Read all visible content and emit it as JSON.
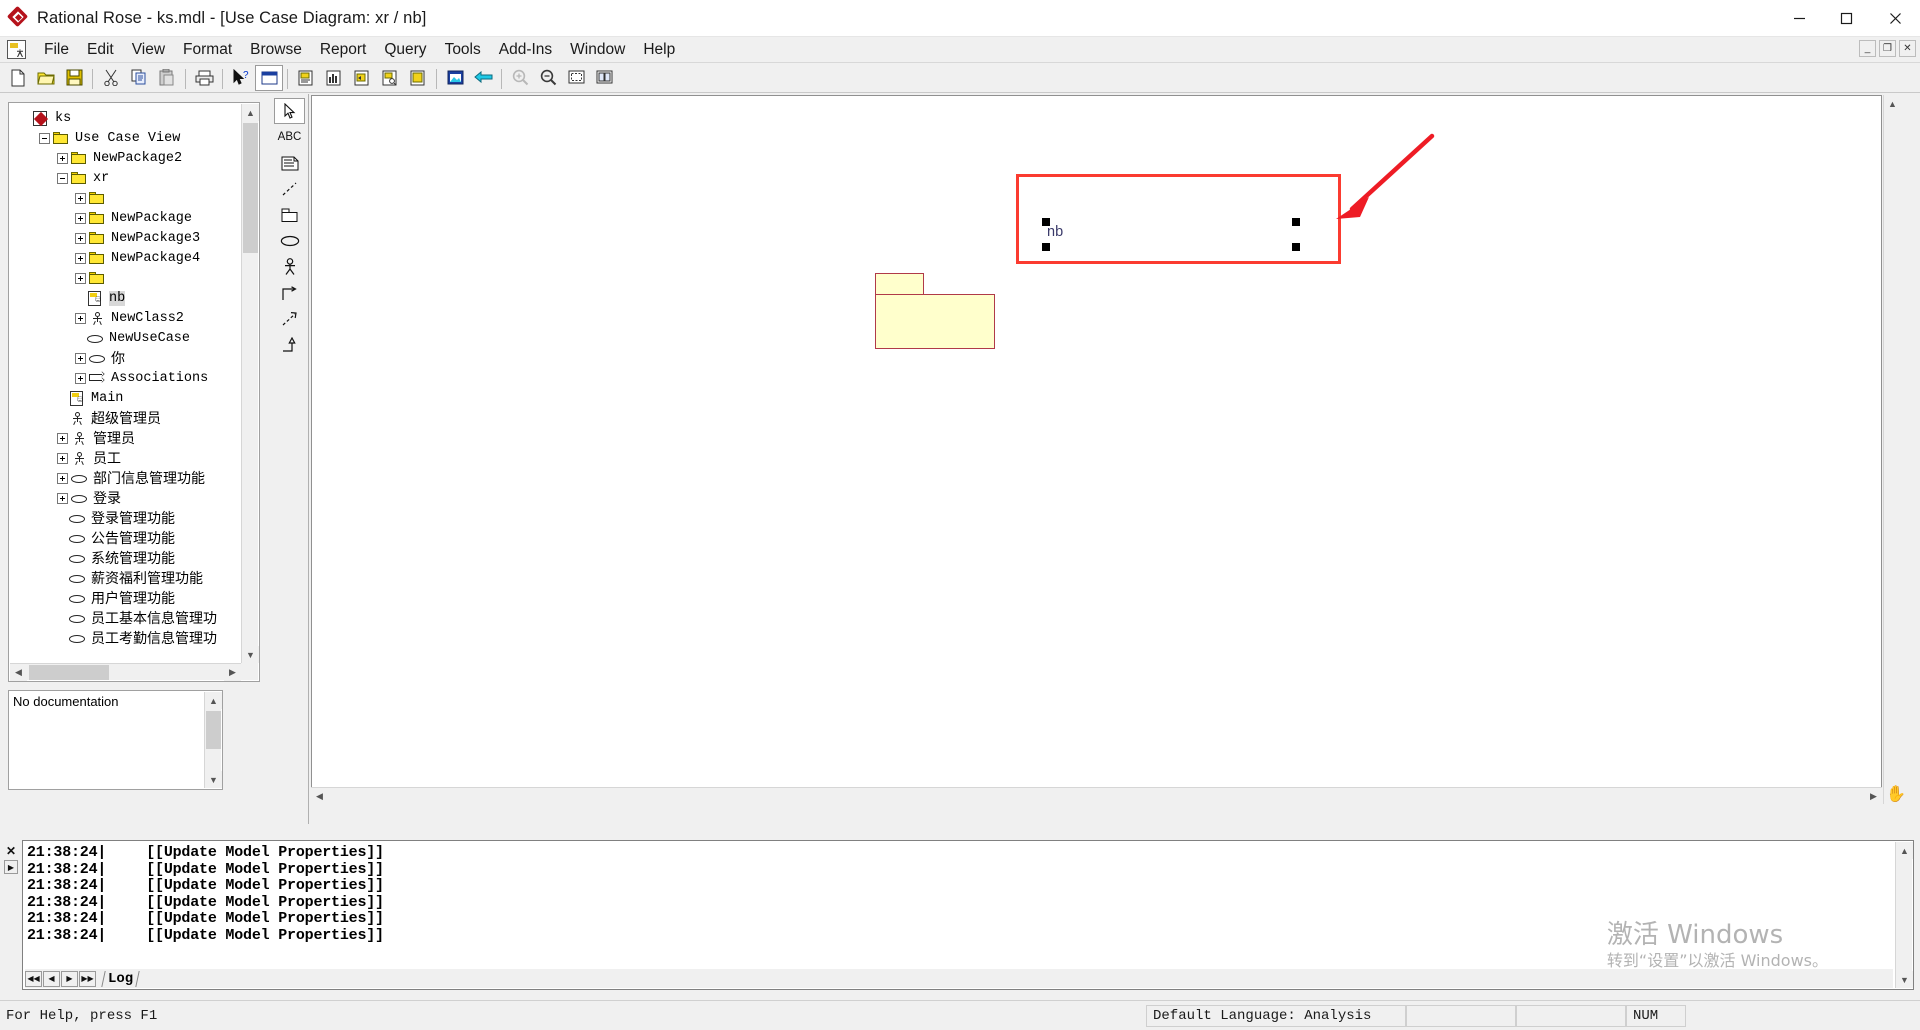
{
  "window": {
    "title": "Rational Rose - ks.mdl - [Use Case Diagram: xr / nb]",
    "app_icon": "rational-rose-diamond-icon",
    "minimize": "minimize-icon",
    "maximize": "maximize-icon",
    "close": "close-icon"
  },
  "menubar": {
    "items": [
      {
        "label": "File"
      },
      {
        "label": "Edit"
      },
      {
        "label": "View"
      },
      {
        "label": "Format"
      },
      {
        "label": "Browse"
      },
      {
        "label": "Report"
      },
      {
        "label": "Query"
      },
      {
        "label": "Tools"
      },
      {
        "label": "Add-Ins"
      },
      {
        "label": "Window"
      },
      {
        "label": "Help"
      }
    ],
    "mdi": {
      "minimize": "_",
      "restore": "❐",
      "close": "✕"
    }
  },
  "toolbar": {
    "buttons": [
      {
        "name": "new-icon"
      },
      {
        "name": "open-icon"
      },
      {
        "name": "save-icon"
      },
      {
        "name": "cut-icon"
      },
      {
        "name": "copy-icon"
      },
      {
        "name": "paste-icon"
      },
      {
        "name": "print-icon"
      },
      {
        "name": "context-help-icon"
      },
      {
        "name": "browse-class-icon"
      },
      {
        "name": "browse-parent-icon"
      },
      {
        "name": "browse-previous-diagram-icon"
      },
      {
        "name": "browse-parent-diagram-icon"
      },
      {
        "name": "browse-specification-icon"
      },
      {
        "name": "fit-in-window-icon"
      },
      {
        "name": "undo-fit-icon"
      },
      {
        "name": "zoom-in-icon"
      },
      {
        "name": "zoom-out-icon"
      },
      {
        "name": "show-hidden-icon"
      },
      {
        "name": "print-preview-icon"
      }
    ],
    "selected_index": 7
  },
  "browser": {
    "title": "browser-tree",
    "nodes": [
      {
        "label": "ks",
        "depth": 0,
        "toggle": "none",
        "icon": "model-icon"
      },
      {
        "label": "Use Case View",
        "depth": 1,
        "toggle": "minus",
        "icon": "folder-icon"
      },
      {
        "label": "NewPackage2",
        "depth": 2,
        "toggle": "plus",
        "icon": "folder-icon"
      },
      {
        "label": "xr",
        "depth": 2,
        "toggle": "minus",
        "icon": "folder-icon"
      },
      {
        "label": "",
        "depth": 3,
        "toggle": "plus",
        "icon": "folder-icon"
      },
      {
        "label": "NewPackage",
        "depth": 3,
        "toggle": "plus",
        "icon": "folder-icon"
      },
      {
        "label": "NewPackage3",
        "depth": 3,
        "toggle": "plus",
        "icon": "folder-icon"
      },
      {
        "label": "NewPackage4",
        "depth": 3,
        "toggle": "plus",
        "icon": "folder-icon"
      },
      {
        "label": "",
        "depth": 3,
        "toggle": "plus",
        "icon": "folder-icon"
      },
      {
        "label": "nb",
        "depth": 3,
        "toggle": "none",
        "icon": "usecase-diagram-icon",
        "selected": true
      },
      {
        "label": "NewClass2",
        "depth": 3,
        "toggle": "plus",
        "icon": "actor-icon"
      },
      {
        "label": "NewUseCase",
        "depth": 3,
        "toggle": "none",
        "icon": "usecase-icon"
      },
      {
        "label": "你",
        "depth": 3,
        "toggle": "plus",
        "icon": "usecase-icon",
        "cjk": true
      },
      {
        "label": "Associations",
        "depth": 3,
        "toggle": "plus",
        "icon": "association-icon"
      },
      {
        "label": "Main",
        "depth": 2,
        "toggle": "none",
        "icon": "usecase-diagram-icon"
      },
      {
        "label": "超级管理员",
        "depth": 2,
        "toggle": "none",
        "icon": "actor-icon",
        "cjk": true
      },
      {
        "label": "管理员",
        "depth": 2,
        "toggle": "plus",
        "icon": "actor-icon",
        "cjk": true
      },
      {
        "label": "员工",
        "depth": 2,
        "toggle": "plus",
        "icon": "actor-icon",
        "cjk": true
      },
      {
        "label": "部门信息管理功能",
        "depth": 2,
        "toggle": "plus",
        "icon": "usecase-icon",
        "cjk": true
      },
      {
        "label": "登录",
        "depth": 2,
        "toggle": "plus",
        "icon": "usecase-icon",
        "cjk": true
      },
      {
        "label": "登录管理功能",
        "depth": 2,
        "toggle": "none",
        "icon": "usecase-icon",
        "cjk": true
      },
      {
        "label": "公告管理功能",
        "depth": 2,
        "toggle": "none",
        "icon": "usecase-icon",
        "cjk": true
      },
      {
        "label": "系统管理功能",
        "depth": 2,
        "toggle": "none",
        "icon": "usecase-icon",
        "cjk": true
      },
      {
        "label": "薪资福利管理功能",
        "depth": 2,
        "toggle": "none",
        "icon": "usecase-icon",
        "cjk": true
      },
      {
        "label": "用户管理功能",
        "depth": 2,
        "toggle": "none",
        "icon": "usecase-icon",
        "cjk": true
      },
      {
        "label": "员工基本信息管理功",
        "depth": 2,
        "toggle": "none",
        "icon": "usecase-icon",
        "cjk": true
      },
      {
        "label": "员工考勤信息管理功",
        "depth": 2,
        "toggle": "none",
        "icon": "usecase-icon",
        "cjk": true
      }
    ]
  },
  "documentation": {
    "text": "No documentation"
  },
  "palette": {
    "tools": [
      {
        "name": "selection-arrow-tool",
        "selected": true
      },
      {
        "name": "text-abc-tool",
        "label": "ABC"
      },
      {
        "name": "note-tool"
      },
      {
        "name": "anchor-note-to-item-tool"
      },
      {
        "name": "package-tool"
      },
      {
        "name": "use-case-tool"
      },
      {
        "name": "actor-tool"
      },
      {
        "name": "unidirectional-association-tool"
      },
      {
        "name": "dependency-tool"
      },
      {
        "name": "generalization-tool"
      }
    ]
  },
  "diagram": {
    "package": {
      "name": "package-shape",
      "fill": "#ffffcc",
      "stroke": "#b03a48"
    },
    "selection": {
      "name": "nb-selection-rectangle",
      "color": "#fb3b30"
    },
    "selected_label": "nb",
    "annotation_arrow": {
      "name": "red-pointer-arrow",
      "color": "#ee1c25"
    }
  },
  "log": {
    "tab_label": "Log",
    "rows": [
      {
        "time": "21:38:24|",
        "message": "[[Update Model Properties]]"
      },
      {
        "time": "21:38:24|",
        "message": "[[Update Model Properties]]"
      },
      {
        "time": "21:38:24|",
        "message": "[[Update Model Properties]]"
      },
      {
        "time": "21:38:24|",
        "message": "[[Update Model Properties]]"
      },
      {
        "time": "21:38:24|",
        "message": "[[Update Model Properties]]"
      },
      {
        "time": "21:38:24|",
        "message": "[[Update Model Properties]]"
      }
    ],
    "nav": {
      "first": "◀◀",
      "prev": "◀",
      "next": "▶",
      "last": "▶▶"
    },
    "close": "✕"
  },
  "statusbar": {
    "help": "For Help, press F1",
    "language": "Default Language: Analysis",
    "cell2": "",
    "cell3": "",
    "num": "NUM"
  },
  "watermark": {
    "line1": "激活 Windows",
    "line2": "转到“设置”以激活 Windows。"
  }
}
